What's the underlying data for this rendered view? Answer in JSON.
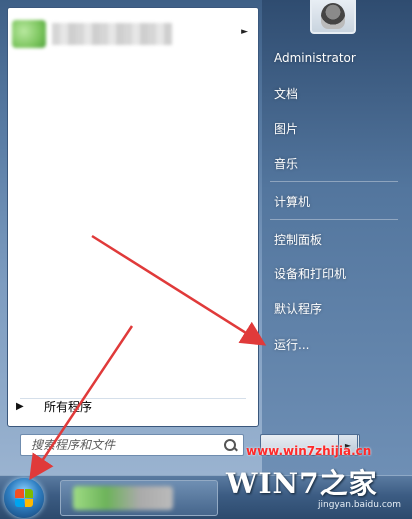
{
  "start_menu": {
    "all_programs_label": "所有程序",
    "search": {
      "placeholder": "搜索程序和文件"
    },
    "right_column": {
      "user_name": "Administrator",
      "items": [
        "文档",
        "图片",
        "音乐",
        "计算机",
        "控制面板",
        "设备和打印机",
        "默认程序",
        "运行..."
      ]
    }
  },
  "watermark": {
    "url": "www.win7zhijia.cn",
    "logo": "WIN7之家",
    "sub": "jingyan.baidu.com"
  },
  "colors": {
    "annotation_arrow": "#e03a3a",
    "watermark_url": "#ff2a2a"
  },
  "icons": [
    "search-icon",
    "windows-flag-icon",
    "user-avatar-icon",
    "chevron-right-icon",
    "triangle-right-icon"
  ]
}
